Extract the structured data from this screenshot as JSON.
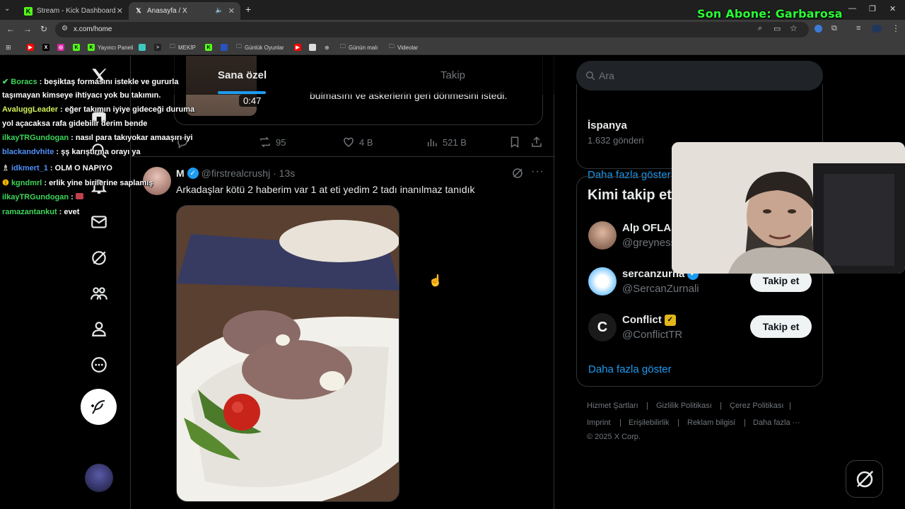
{
  "browser": {
    "tabs": [
      {
        "title": "Stream - Kick Dashboard",
        "icon": "K"
      },
      {
        "title": "Anasayfa / X",
        "icon": "X"
      }
    ],
    "url": "x.com/home",
    "bookmarks": [
      "Yayıncı Paneli",
      "MEKİP",
      "Günlük Oyunlar",
      "Günün malı",
      "Videolar"
    ]
  },
  "stream_overlay": {
    "subscriber_text": "Son Abone: Garbarosa"
  },
  "chat": [
    {
      "user": "Boracs",
      "color": "#3dd65a",
      "msg": ": beşiktaş formasını istekle ve gururla"
    },
    {
      "user": "",
      "color": "#fff",
      "msg": "taşımayan kimseye ihtiyacı yok bu takımın."
    },
    {
      "user": "AvaluggLeader",
      "color": "#d2f05a",
      "msg": ": eğer takımın iyiye gideceği duruma"
    },
    {
      "user": "",
      "color": "#fff",
      "msg": "yol açacaksa rafa gidebilir derim bende"
    },
    {
      "user": "ilkayTRGundogan",
      "color": "#3dd65a",
      "msg": ": nasıl para takıyokar amaaşırı iyi"
    },
    {
      "user": "blackandvhite",
      "color": "#4f8ff7",
      "msg": ": şş karıştırma orayı ya"
    },
    {
      "user": "idkmert_1",
      "color": "#4f8ff7",
      "msg": ": OLM O NAPIYO"
    },
    {
      "user": "kgndmrl",
      "color": "#3dd65a",
      "msg": ": erlik yine birilerine saplamış"
    },
    {
      "user": "ilkayTRGundogan",
      "color": "#3dd65a",
      "msg": ":"
    },
    {
      "user": "ramazantankut",
      "color": "#3dd65a",
      "msg": ": evet"
    }
  ],
  "feed": {
    "tabs": [
      "Sana özel",
      "Takip"
    ],
    "prev_post": {
      "duration": "0:47",
      "text": "bulmasını ve askerlerin geri dönmesini istedi.",
      "retweets": "95",
      "likes": "4 B",
      "views": "521 B"
    },
    "post": {
      "name": "M",
      "handle": "@firstrealcrushj",
      "time": "· 13s",
      "text": "Arkadaşlar kötü 2 haberim var 1 at eti yedim 2 tadı inanılmaz tanıdık"
    }
  },
  "sidebar": {
    "search_placeholder": "Ara",
    "trend": {
      "name": "İspanya",
      "count": "1.632 gönderi",
      "show_more": "Daha fazla göster"
    },
    "who_to_follow": {
      "title": "Kimi takip et",
      "users": [
        {
          "name": "Alp OFLAS",
          "handle": "@greyness",
          "badge": "none"
        },
        {
          "name": "sercanzurna",
          "handle": "@SercanZurnali",
          "badge": "blue",
          "button": "Takip et"
        },
        {
          "name": "Conflict",
          "handle": "@ConflictTR",
          "badge": "gold",
          "button": "Takip et"
        }
      ],
      "show_more": "Daha fazla göster"
    },
    "footer": {
      "links": [
        "Hizmet Şartları",
        "Gizlilik Politikası",
        "Çerez Politikası",
        "Imprint",
        "Erişilebilirlik",
        "Reklam bilgisi",
        "Daha fazla ···"
      ],
      "copyright": "© 2025 X Corp."
    }
  },
  "colors": {
    "accent": "#1d9bf0",
    "bg": "#000000",
    "border": "#2f3336",
    "muted": "#71767b",
    "overlay_green": "#2bff36"
  }
}
